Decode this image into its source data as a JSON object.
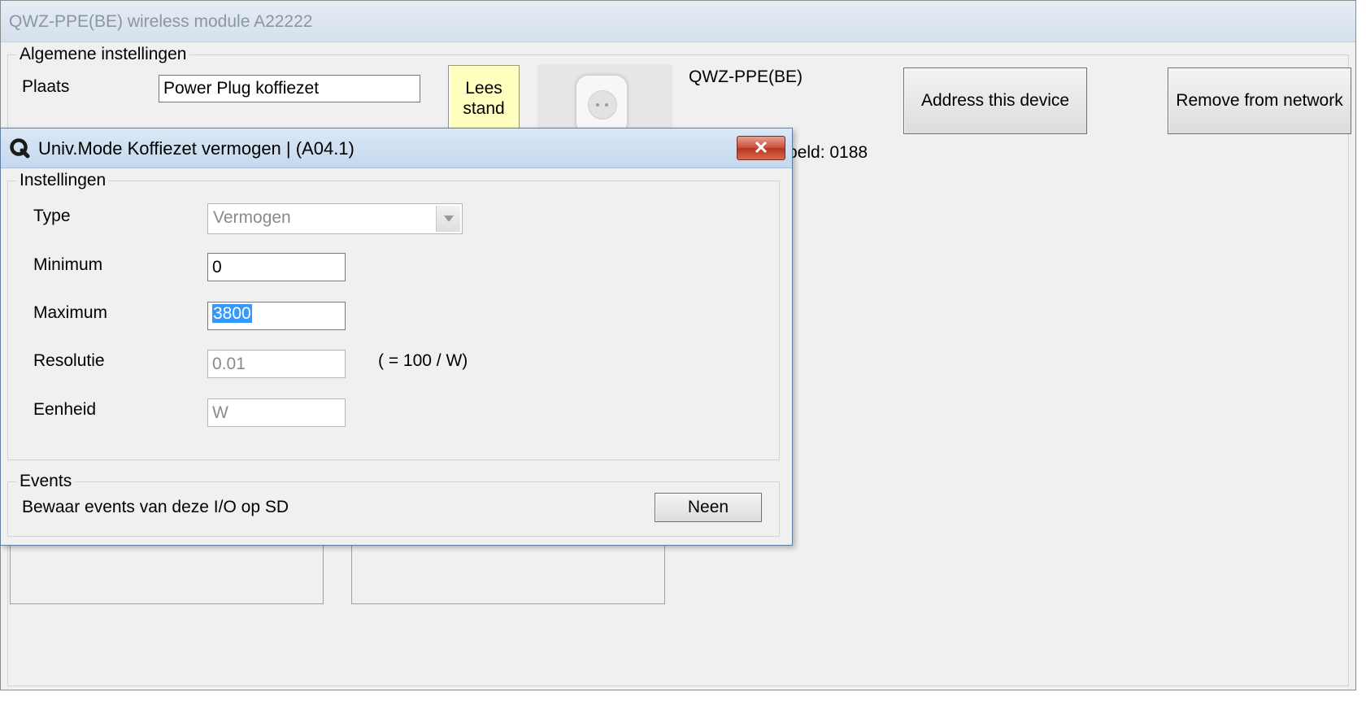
{
  "main_window": {
    "title": "QWZ-PPE(BE) wireless module A22222",
    "general": {
      "legend": "Algemene instellingen",
      "plaats_label": "Plaats",
      "plaats_value": "Power Plug koffiezet",
      "lees_stand_line1": "Lees",
      "lees_stand_line2": "stand",
      "device_model": "QWZ-PPE(BE)",
      "peld_text": "peld: 0188",
      "address_button": "Address this device",
      "remove_button": "Remove from network"
    }
  },
  "dialog": {
    "title": "Univ.Mode Koffiezet vermogen |  (A04.1)",
    "close_symbol": "✕",
    "instellingen": {
      "legend": "Instellingen",
      "type_label": "Type",
      "type_value": "Vermogen",
      "minimum_label": "Minimum",
      "minimum_value": "0",
      "maximum_label": "Maximum",
      "maximum_value": "3800",
      "resolutie_label": "Resolutie",
      "resolutie_value": "0.01",
      "resolutie_note": "( = 100 / W)",
      "eenheid_label": "Eenheid",
      "eenheid_value": "W"
    },
    "events": {
      "legend": "Events",
      "description": "Bewaar events van deze I/O op SD",
      "button": "Neen"
    }
  },
  "icons": {
    "dialog_icon": "app-q-icon",
    "combo_arrow": "chevron-down-icon",
    "close": "close-icon"
  }
}
